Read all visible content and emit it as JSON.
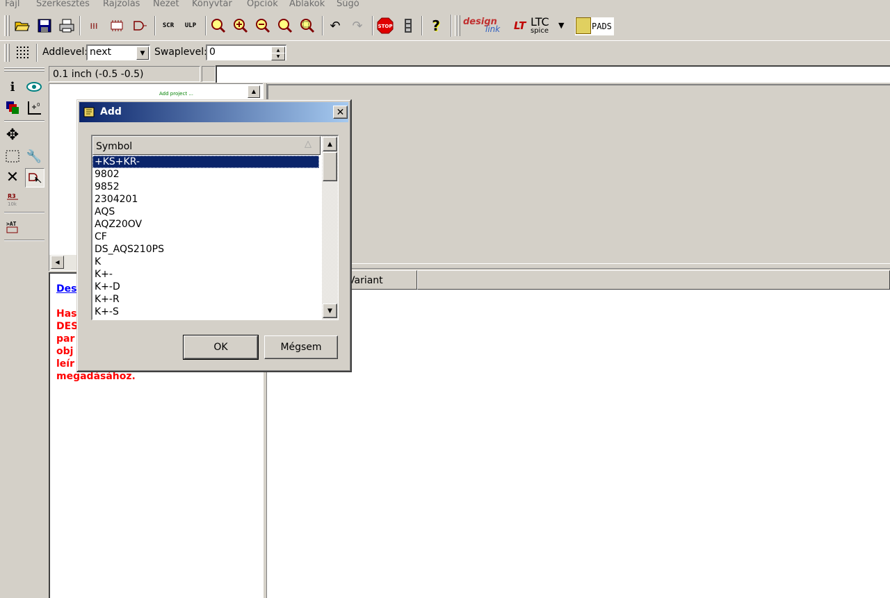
{
  "menu": [
    "Fájl",
    "Szerkesztés",
    "Rajzolás",
    "Nézet",
    "Könyvtár",
    "Opciók",
    "Ablakok",
    "Súgó"
  ],
  "toolbar2": {
    "addlevel_label": "Addlevel:",
    "addlevel_value": "next",
    "swaplevel_label": "Swaplevel:",
    "swaplevel_value": "0"
  },
  "coords": "0.1 inch (-0.5 -0.5)",
  "brand": {
    "designlink_top": "design",
    "designlink_bottom": "link",
    "ltc_main": "LTC",
    "ltc_sub": "spice",
    "pads": "PADS",
    "stop": "STOP"
  },
  "preview_text": "Add project ...",
  "info_panel": {
    "link": "Des",
    "lines": [
      "Has",
      "DES",
      "par",
      "obj",
      "leír",
      "megadásához."
    ]
  },
  "table_header": {
    "variant": "Variant"
  },
  "dialog": {
    "title": "Add",
    "column_header": "Symbol",
    "items": [
      "+KS+KR-",
      "9802",
      "9852",
      "2304201",
      "AQS",
      "AQZ20OV",
      "CF",
      "DS_AQS210PS",
      "K",
      "K+-",
      "K+-D",
      "K+-R",
      "K+-S"
    ],
    "selected_index": 0,
    "ok_label": "OK",
    "cancel_label": "Mégsem"
  },
  "colors": {
    "title_start": "#0a246a",
    "title_end": "#a6caf0",
    "selection": "#0a246a",
    "face": "#d4d0c8",
    "red_text": "#ff0000"
  }
}
